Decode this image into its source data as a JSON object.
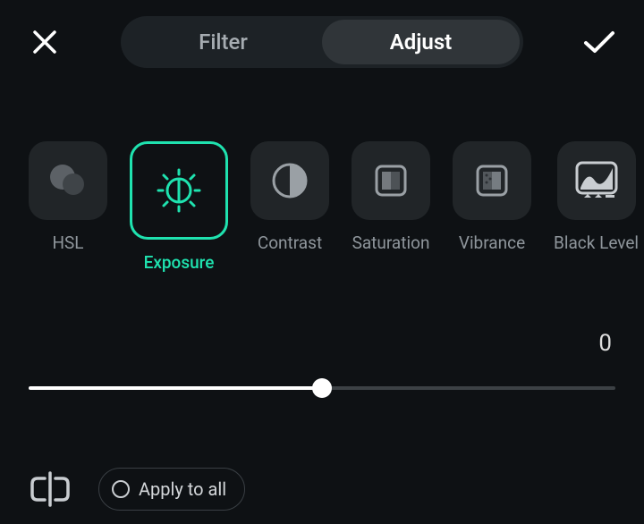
{
  "tabs": {
    "filter": "Filter",
    "adjust": "Adjust",
    "active": "adjust"
  },
  "tools": [
    {
      "id": "hsl",
      "label": "HSL"
    },
    {
      "id": "exposure",
      "label": "Exposure"
    },
    {
      "id": "contrast",
      "label": "Contrast"
    },
    {
      "id": "saturation",
      "label": "Saturation"
    },
    {
      "id": "vibrance",
      "label": "Vibrance"
    },
    {
      "id": "blacklevel",
      "label": "Black Level"
    }
  ],
  "selected_tool": "exposure",
  "slider": {
    "value": "0",
    "min": -100,
    "max": 100,
    "position_pct": 50
  },
  "apply_all_label": "Apply to all",
  "colors": {
    "accent": "#1fe2af",
    "bg": "#0e1114"
  }
}
